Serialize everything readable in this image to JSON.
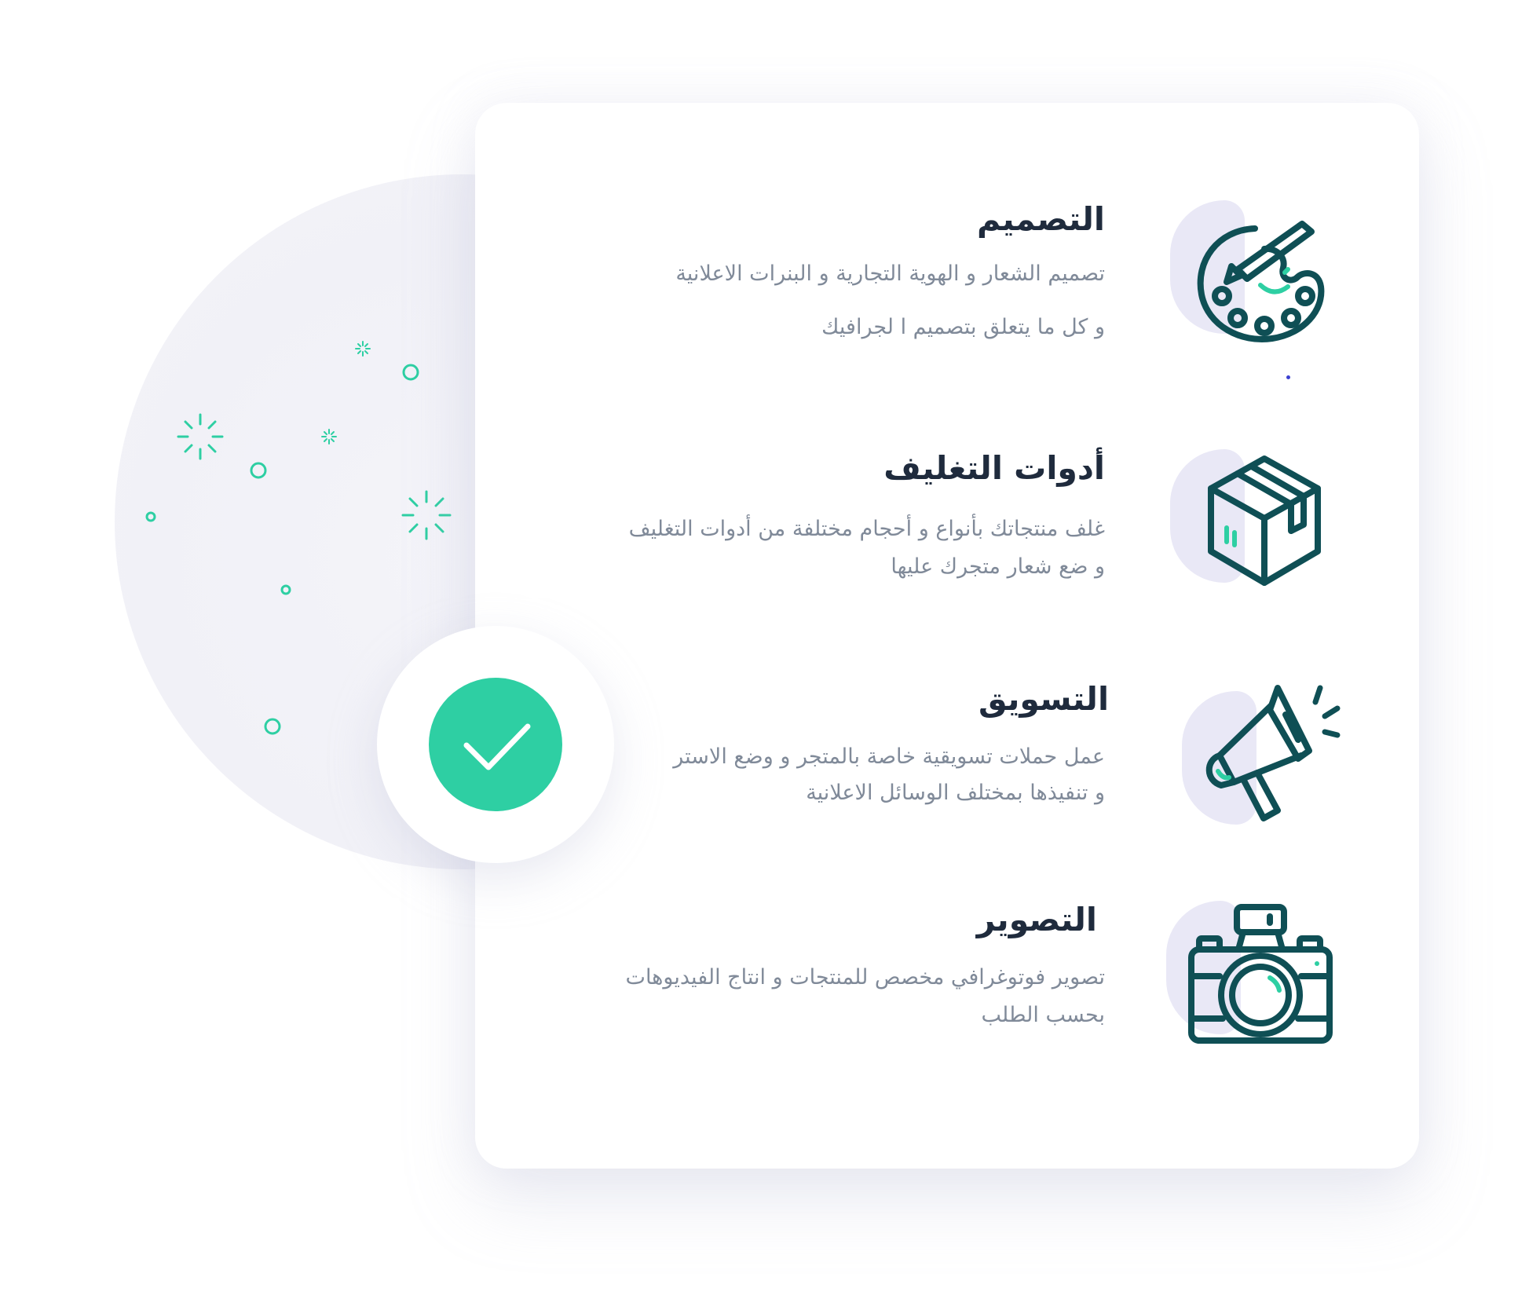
{
  "colors": {
    "accent": "#2ecfa3",
    "icon_stroke": "#0f4f55",
    "title": "#1f2b3d",
    "text": "#808a99",
    "blob": "#e9e8f6",
    "background_circle": "#f1f1f7"
  },
  "services": [
    {
      "title": "التصميم",
      "lines": [
        "تصميم الشعار و الهوية التجارية و البنرات الاعلانية",
        "و كل ما يتعلق بتصميم ا  لجرافيك"
      ],
      "icon": "palette-icon"
    },
    {
      "title": "أدوات التغليف",
      "lines": [
        "غلف منتجاتك بأنواع و أحجام مختلفة من أدوات التغليف",
        "و ضع شعار متجرك عليها"
      ],
      "icon": "package-box-icon"
    },
    {
      "title": "التسويق",
      "lines": [
        "عمل حملات تسويقية خاصة بالمتجر و وضع الاستر",
        "و تنفيذها بمختلف الوسائل الاعلانية"
      ],
      "icon": "megaphone-icon"
    },
    {
      "title": "التصوير",
      "lines": [
        "تصوير فوتوغرافي مخصص للمنتجات و انتاج الفيديوهات",
        "بحسب الطلب"
      ],
      "icon": "camera-icon"
    }
  ],
  "badge": {
    "icon": "checkmark-icon"
  }
}
